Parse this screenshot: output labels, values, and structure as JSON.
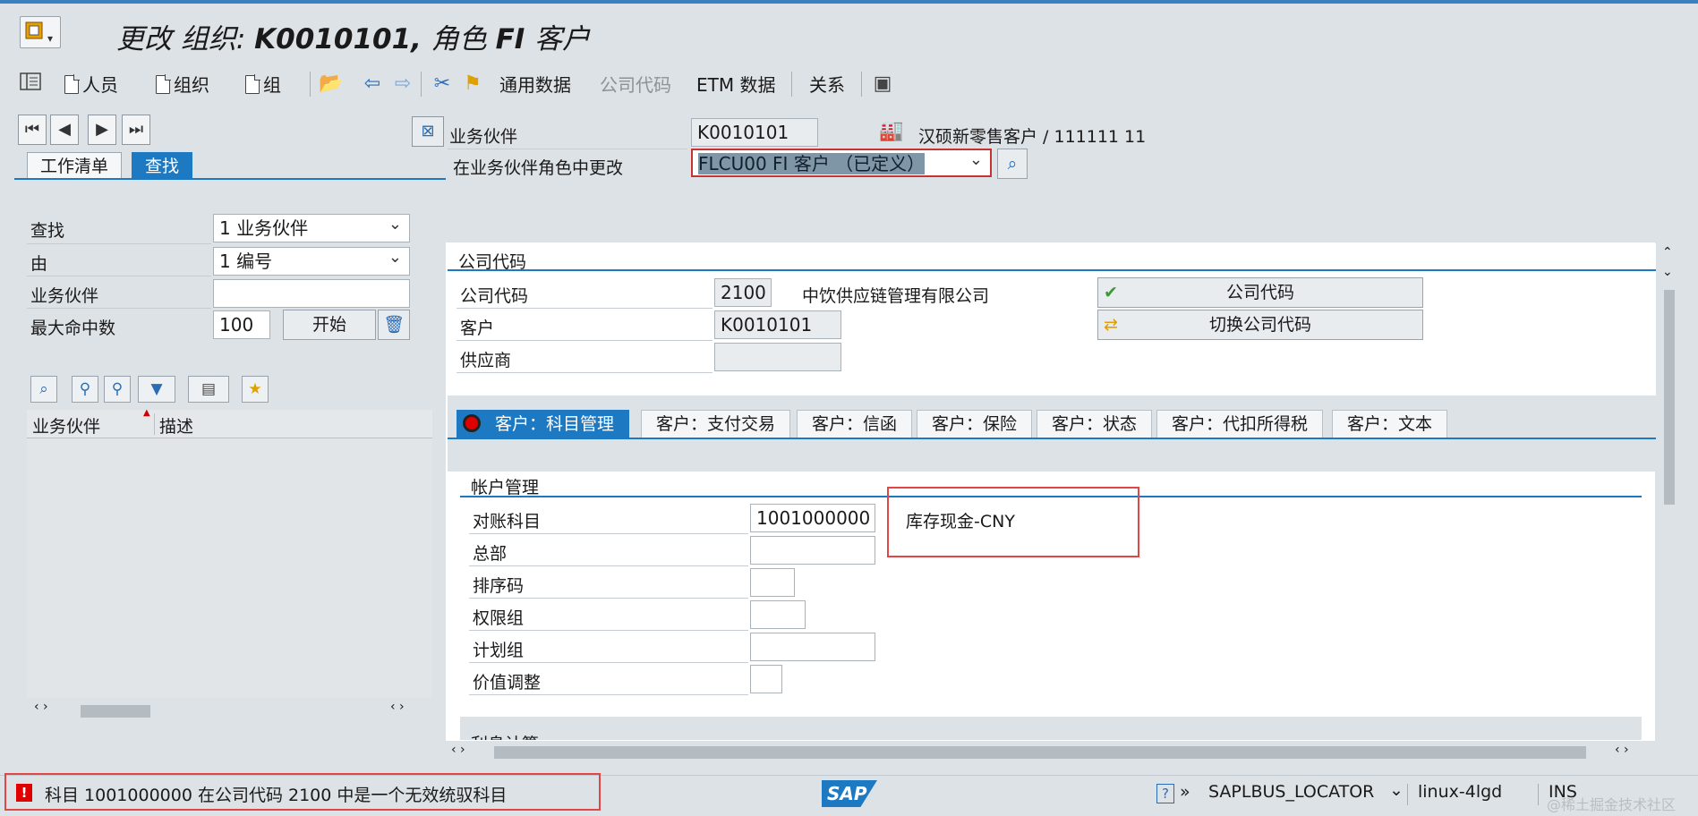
{
  "title": {
    "prefix": "更改 组织: ",
    "bold": "K0010101, ",
    "role": "角色 ",
    "rolebold": "FI ",
    "suffix": "客户"
  },
  "toolbar": {
    "person": "人员",
    "org": "组织",
    "group": "组",
    "general_data": "通用数据",
    "company_code": "公司代码",
    "etm_data": "ETM 数据",
    "relations": "关系"
  },
  "left": {
    "tabs": [
      "工作清单",
      "查找"
    ],
    "find_label": "查找",
    "find_value": "1 业务伙伴",
    "by_label": "由",
    "by_value": "1 编号",
    "bp_label": "业务伙伴",
    "bp_value": "",
    "max_hits_label": "最大命中数",
    "max_hits_value": "100",
    "start_button": "开始",
    "list_headers": [
      "业务伙伴",
      "描述"
    ]
  },
  "header": {
    "bp_label": "业务伙伴",
    "bp_value": "K0010101",
    "bp_name": "汉硕新零售客户 / 111111 11",
    "role_label": "在业务伙伴角色中更改",
    "role_value": "FLCU00 FI 客户 （已定义）"
  },
  "company": {
    "section_title": "公司代码",
    "cc_label": "公司代码",
    "cc_value": "2100",
    "cc_name": "中饮供应链管理有限公司",
    "customer_label": "客户",
    "customer_value": "K0010101",
    "vendor_label": "供应商",
    "vendor_value": "",
    "cc_button": "公司代码",
    "switch_button": "切换公司代码"
  },
  "tabs": [
    "客户：科目管理",
    "客户：支付交易",
    "客户：信函",
    "客户：保险",
    "客户：状态",
    "客户：代扣所得税",
    "客户：文本"
  ],
  "account": {
    "section_title": "帐户管理",
    "recon_label": "对账科目",
    "recon_value": "1001000000",
    "recon_desc": "库存现金-CNY",
    "head_office_label": "总部",
    "sort_key_label": "排序码",
    "auth_group_label": "权限组",
    "planning_group_label": "计划组",
    "value_adj_label": "价值调整",
    "next_section": "利息计算"
  },
  "status": {
    "message": "科目 1001000000 在公司代码 2100 中是一个无效统驭科目",
    "sap_logo": "SAP",
    "program": "SAPLBUS_LOCATOR",
    "server": "linux-4lgd",
    "mode": "INS",
    "watermark": "@稀土掘金技术社区"
  }
}
